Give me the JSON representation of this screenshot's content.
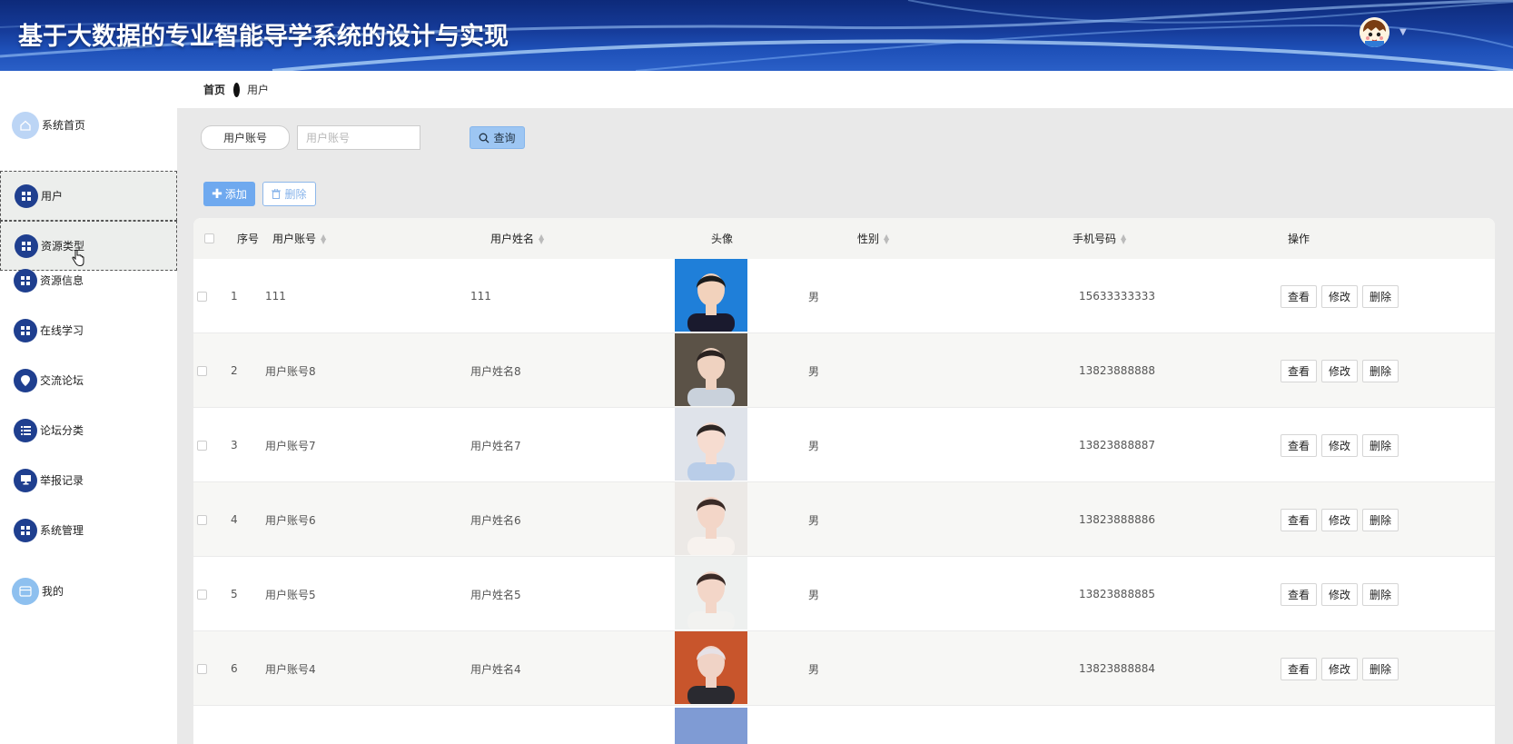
{
  "header": {
    "title": "基于大数据的专业智能导学系统的设计与实现",
    "user_menu_caret": "▼"
  },
  "sidebar": {
    "items": [
      {
        "label": "系统首页",
        "icon": "home-icon"
      },
      {
        "label": "用户",
        "icon": "grid-icon"
      },
      {
        "label": "资源类型",
        "icon": "grid-icon"
      },
      {
        "label": "资源信息",
        "icon": "grid-icon"
      },
      {
        "label": "在线学习",
        "icon": "grid-icon"
      },
      {
        "label": "交流论坛",
        "icon": "location-icon"
      },
      {
        "label": "论坛分类",
        "icon": "list-icon"
      },
      {
        "label": "举报记录",
        "icon": "monitor-icon"
      },
      {
        "label": "系统管理",
        "icon": "grid-icon"
      },
      {
        "label": "我的",
        "icon": "card-icon"
      }
    ]
  },
  "breadcrumb": {
    "home": "首页",
    "current": "用户"
  },
  "search": {
    "label": "用户账号",
    "placeholder": "用户账号",
    "query_label": "查询"
  },
  "toolbar": {
    "add_label": "添加",
    "delete_label": "删除"
  },
  "table": {
    "columns": {
      "index": "序号",
      "account": "用户账号",
      "name": "用户姓名",
      "avatar": "头像",
      "gender": "性别",
      "phone": "手机号码",
      "actions": "操作"
    },
    "action_labels": {
      "view": "查看",
      "edit": "修改",
      "delete": "删除"
    },
    "rows": [
      {
        "index": "1",
        "account": "111",
        "name": "111",
        "gender": "男",
        "phone": "15633333333"
      },
      {
        "index": "2",
        "account": "用户账号8",
        "name": "用户姓名8",
        "gender": "男",
        "phone": "13823888888"
      },
      {
        "index": "3",
        "account": "用户账号7",
        "name": "用户姓名7",
        "gender": "男",
        "phone": "13823888887"
      },
      {
        "index": "4",
        "account": "用户账号6",
        "name": "用户姓名6",
        "gender": "男",
        "phone": "13823888886"
      },
      {
        "index": "5",
        "account": "用户账号5",
        "name": "用户姓名5",
        "gender": "男",
        "phone": "13823888885"
      },
      {
        "index": "6",
        "account": "用户账号4",
        "name": "用户姓名4",
        "gender": "男",
        "phone": "13823888884"
      }
    ]
  },
  "colors": {
    "header_dark": "#0d2a7a",
    "accent_blue": "#6fa9ef",
    "sidebar_icon": "#1f3f8f"
  }
}
